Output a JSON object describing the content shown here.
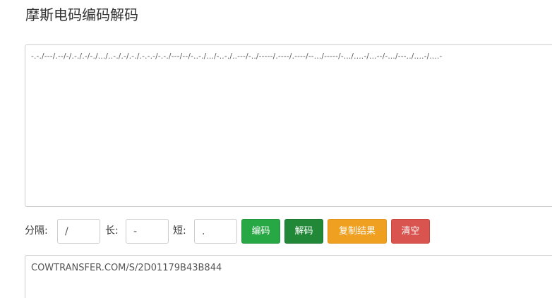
{
  "title": "摩斯电码编码解码",
  "morse_input": {
    "value": "-.-./---/.--/-/.-./.-/-./.../..-./.-/.-./.-.-.-/-.-./---/--/-..-./.../-..-./..---/-../-----/.----/.----/--.../-----/-.../....-/...--/-.../---../....-/....-"
  },
  "controls": {
    "separator_label": "分隔:",
    "separator_value": "/",
    "long_label": "长:",
    "long_value": "-",
    "short_label": "短:",
    "short_value": ".",
    "encode_label": "编码",
    "decode_label": "解码",
    "copy_label": "复制结果",
    "clear_label": "清空"
  },
  "result": {
    "value": "COWTRANSFER.COM/S/2D01179B43B844"
  },
  "colors": {
    "encode": "#28a745",
    "decode": "#218838",
    "copy": "#f0a020",
    "clear": "#d9534f"
  }
}
